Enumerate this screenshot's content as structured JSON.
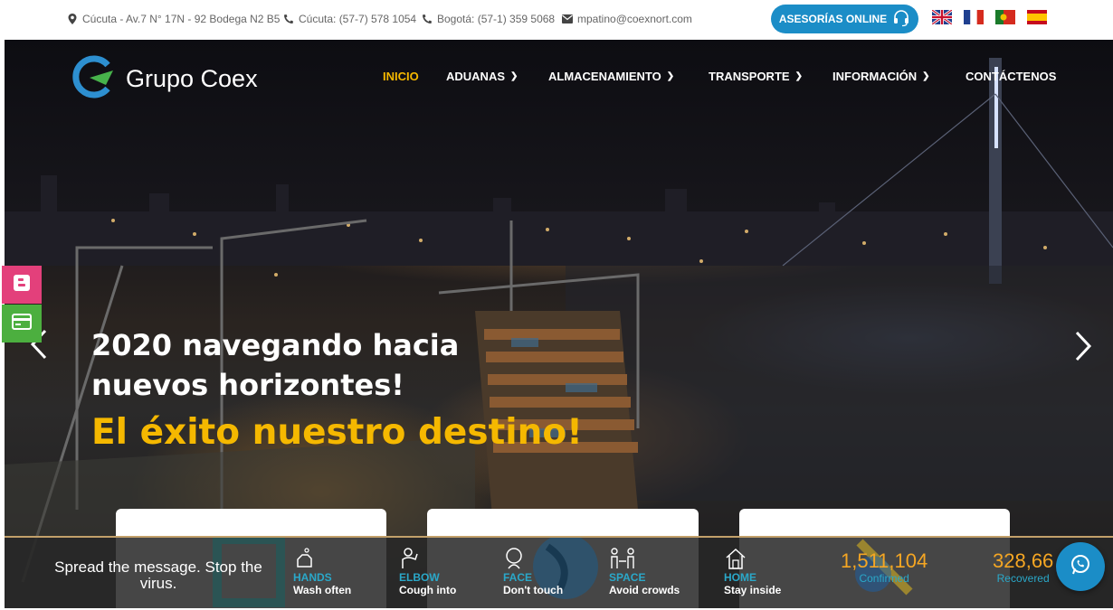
{
  "topbar": {
    "address": "Cúcuta - Av.7 N° 17N - 92 Bodega N2 B5",
    "phone_cucuta": "Cúcuta: (57-7) 578 1054",
    "phone_bogota": "Bogotá: (57-1) 359 5068",
    "email": "mpatino@coexnort.com",
    "asesoria_label": "ASESORÍAS ONLINE",
    "languages": [
      "english-flag",
      "french-flag",
      "portuguese-flag",
      "spanish-flag"
    ]
  },
  "header": {
    "logo_text": "Grupo Coex",
    "nav": [
      {
        "label": "INICIO",
        "active": true
      },
      {
        "label": "ADUANAS",
        "dropdown": true
      },
      {
        "label": "ALMACENAMIENTO",
        "dropdown": true
      },
      {
        "label": "TRANSPORTE",
        "dropdown": true
      },
      {
        "label": "INFORMACIÓN",
        "dropdown": true
      },
      {
        "label": "CONTÁCTENOS"
      }
    ]
  },
  "hero": {
    "title": "2020 navegando hacia nuevos horizontes!",
    "subtitle": "El éxito nuestro destino!"
  },
  "covid": {
    "message": "Spread the message. Stop the virus.",
    "tips": [
      {
        "title": "HANDS",
        "desc": "Wash often",
        "icon": "hand-wash-icon"
      },
      {
        "title": "ELBOW",
        "desc": "Cough into",
        "icon": "elbow-cough-icon"
      },
      {
        "title": "FACE",
        "desc": "Don't touch",
        "icon": "face-icon"
      },
      {
        "title": "SPACE",
        "desc": "Avoid crowds",
        "icon": "distance-icon"
      },
      {
        "title": "HOME",
        "desc": "Stay inside",
        "icon": "home-icon"
      }
    ],
    "stats": [
      {
        "value": "1,511,104",
        "label": "Confirmed"
      },
      {
        "value": "328,66",
        "label": "Recovered"
      }
    ]
  },
  "colors": {
    "accent_blue": "#1b8dc7",
    "accent_yellow": "#f5b800",
    "covid_teal": "#2aa8c9",
    "stat_orange": "#f5a623"
  }
}
